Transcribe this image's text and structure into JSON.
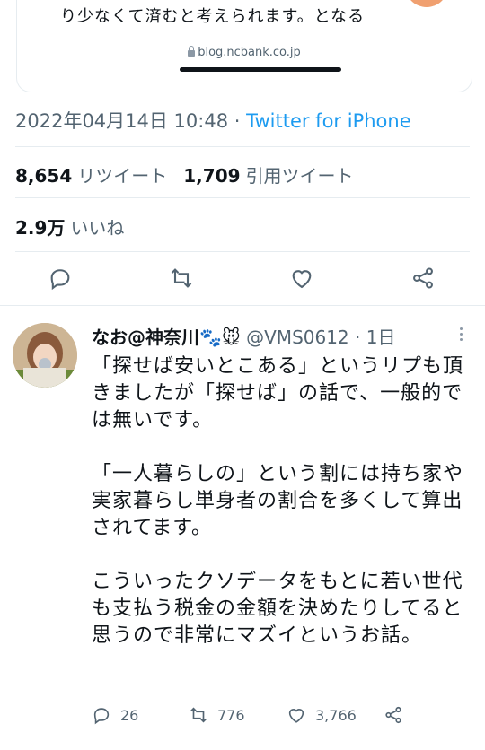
{
  "link_card": {
    "snippet": "り少なくて済むと考えられます。となる",
    "domain": "blog.ncbank.co.jp"
  },
  "tweet": {
    "timestamp": "2022年04月14日 10:48",
    "separator": " · ",
    "source": "Twitter for iPhone",
    "retweets": {
      "value": "8,654",
      "label": "リツイート"
    },
    "quotes": {
      "value": "1,709",
      "label": "引用ツイート"
    },
    "likes": {
      "value": "2.9万",
      "label": "いいね"
    },
    "action_icons": [
      "reply-icon",
      "retweet-icon",
      "like-icon",
      "share-icon"
    ]
  },
  "reply": {
    "display_name": "なお@神奈川🐾🐭",
    "handle": "@VMS0612",
    "separator": " · ",
    "age": "1日",
    "paragraphs": [
      "「探せば安いとこある」というリプも頂きましたが「探せば」の話で、一般的では無いです。",
      "「一人暮らしの」という割には持ち家や実家暮らし単身者の割合を多くして算出されてます。",
      "こういったクソデータをもとに若い世代も支払う税金の金額を決めたりしてると思うので非常にマズイというお話。"
    ],
    "counts": {
      "replies": "26",
      "retweets": "776",
      "likes": "3,766"
    }
  },
  "colors": {
    "accent": "#1d9bf0",
    "secondary_text": "#536471",
    "divider": "#e6ecf0"
  }
}
